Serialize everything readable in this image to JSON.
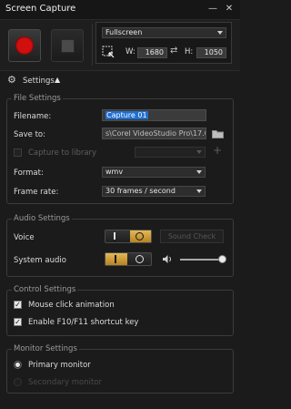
{
  "window": {
    "title": "Screen Capture"
  },
  "area": {
    "mode": "Fullscreen",
    "width_label": "W:",
    "width_value": "1680",
    "height_label": "H:",
    "height_value": "1050"
  },
  "settings_toggle": {
    "label": "Settings"
  },
  "file_settings": {
    "title": "File Settings",
    "filename_label": "Filename:",
    "filename_value": "Capture 01",
    "saveto_label": "Save to:",
    "saveto_value": "s\\Corel VideoStudio Pro\\17.0\\",
    "capture_library_label": "Capture to library",
    "format_label": "Format:",
    "format_value": "wmv",
    "framerate_label": "Frame rate:",
    "framerate_value": "30 frames / second"
  },
  "audio_settings": {
    "title": "Audio Settings",
    "voice_label": "Voice",
    "sound_check_label": "Sound Check",
    "system_audio_label": "System audio",
    "system_audio_volume": 0.93
  },
  "control_settings": {
    "title": "Control Settings",
    "mouse_click_label": "Mouse click animation",
    "shortcut_label": "Enable F10/F11 shortcut key"
  },
  "monitor_settings": {
    "title": "Monitor Settings",
    "primary_label": "Primary monitor",
    "secondary_label": "Secondary monitor"
  },
  "colors": {
    "accent": "#c89a3a",
    "record": "#d10f0f",
    "selection": "#1f6fd1"
  }
}
